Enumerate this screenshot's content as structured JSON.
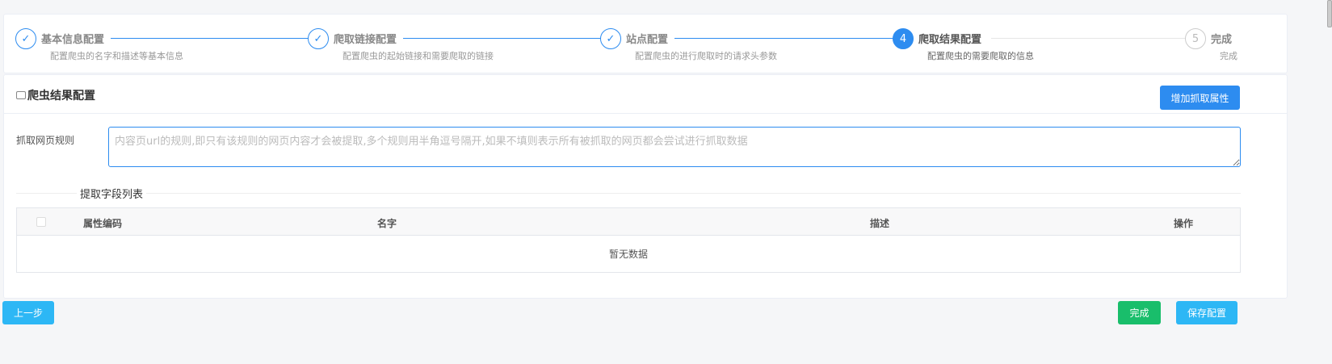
{
  "steps": [
    {
      "title": "基本信息配置",
      "desc": "配置爬虫的名字和描述等基本信息",
      "icon": "check-icon",
      "state": "finish"
    },
    {
      "title": "爬取链接配置",
      "desc": "配置爬虫的起始链接和需要爬取的链接",
      "icon": "check-icon",
      "state": "finish"
    },
    {
      "title": "站点配置",
      "desc": "配置爬虫的进行爬取时的请求头参数",
      "icon": "check-icon",
      "state": "finish"
    },
    {
      "title": "爬取结果配置",
      "desc": "配置爬虫的需要爬取的信息",
      "number": "4",
      "state": "process"
    },
    {
      "title": "完成",
      "desc": "完成",
      "number": "5",
      "state": "wait"
    }
  ],
  "main": {
    "title": "爬虫结果配置",
    "add_button": "增加抓取属性",
    "rule_label": "抓取网页规则",
    "rule_value": "",
    "rule_placeholder": "内容页url的规则,即只有该规则的网页内容才会被提取,多个规则用半角逗号隔开,如果不填则表示所有被抓取的网页都会尝试进行抓取数据",
    "divider_text": "提取字段列表",
    "table": {
      "columns": [
        "属性编码",
        "名字",
        "描述",
        "操作"
      ],
      "rows": [],
      "empty_text": "暂无数据"
    }
  },
  "footer": {
    "prev_button": "上一步",
    "finish_button": "完成",
    "save_button": "保存配置"
  },
  "colors": {
    "primary": "#2d8cf0",
    "info": "#2db7f5",
    "success": "#19be6b"
  }
}
